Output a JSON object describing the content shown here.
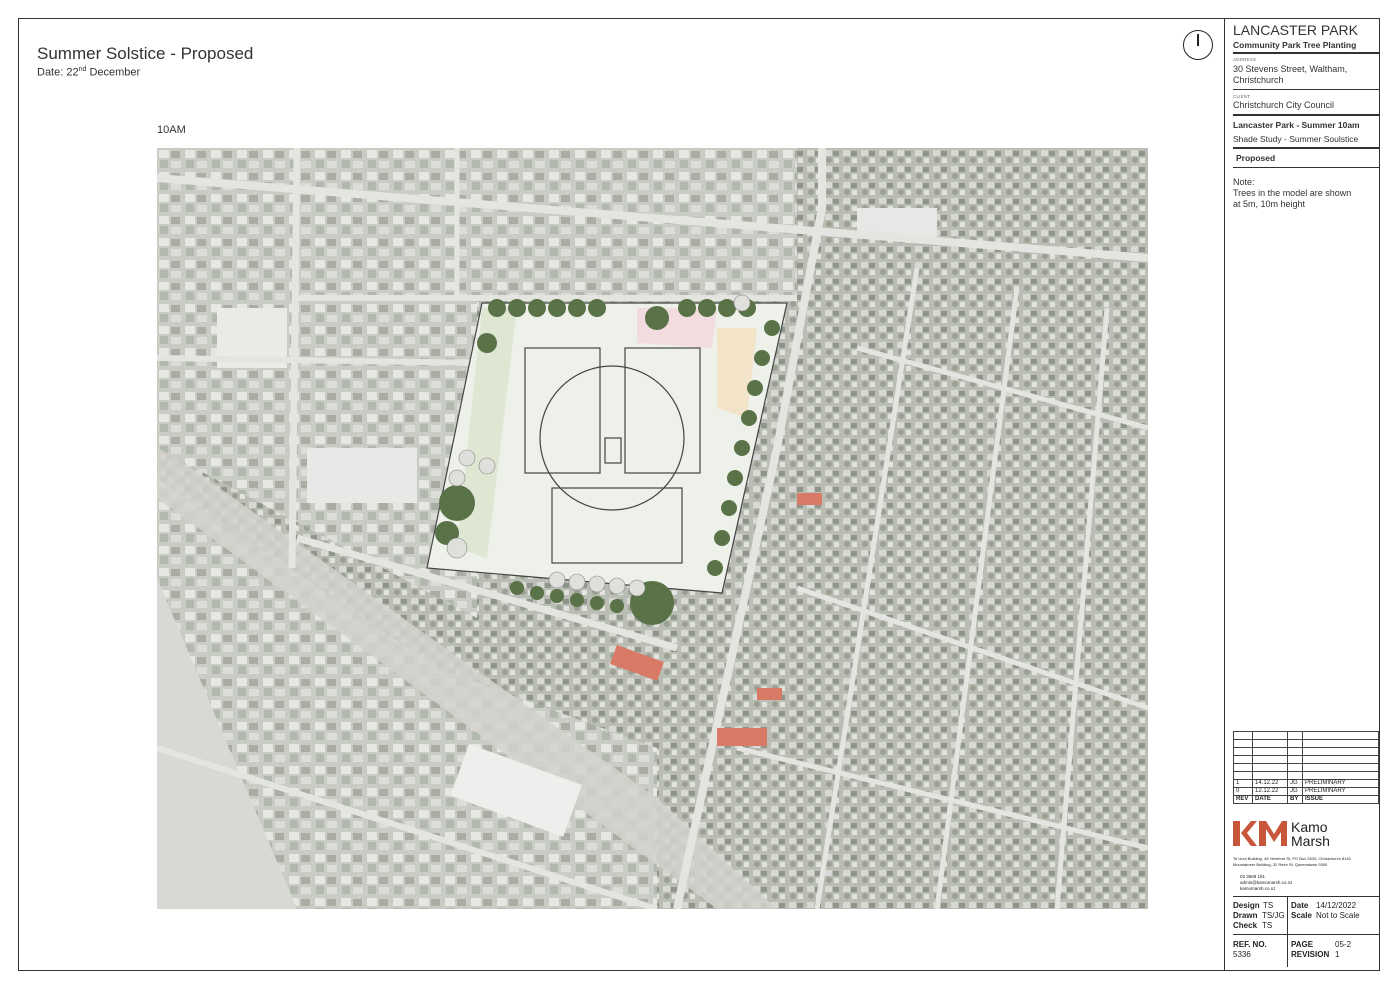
{
  "header": {
    "title": "Summer Solstice - Proposed",
    "date_prefix": "Date: 22",
    "date_sup": "nd",
    "date_suffix": " December",
    "time_label": "10AM"
  },
  "titleblock": {
    "project_name": "LANCASTER PARK",
    "project_subtitle": "Community Park Tree Planting",
    "address_label": "ADDRESS",
    "address_line1": "30 Stevens Street, Waltham,",
    "address_line2": "Christchurch",
    "client_label": "CLIENT",
    "client": "Christchurch City Council",
    "drawing_title": "Lancaster Park - Summer 10am",
    "drawing_subtitle": "Shade Study - Summer Soulstice",
    "status": "Proposed",
    "note_label": "Note:",
    "note_line1": "Trees in the model are shown",
    "note_line2": "at 5m, 10m height"
  },
  "revisions": {
    "rows": [
      {
        "rev": "1",
        "date": "14.12.22",
        "by": "JG",
        "issue": "PRELIMINARY"
      },
      {
        "rev": "0",
        "date": "12.12.22",
        "by": "JG",
        "issue": "PRELIMINARY"
      }
    ],
    "headers": {
      "rev": "REV",
      "date": "DATE",
      "by": "BY",
      "issue": "ISSUE"
    }
  },
  "company": {
    "name_line1": "Kamo",
    "name_line2": "Marsh",
    "brand_color": "#c8563a",
    "address_line1": "Te Unui Building, 48 Hereford St, PO Box 2833, Christchurch 8140",
    "address_line2": "Mountaineer Building, 32 Rees St, Queenstown 9300",
    "phone": "03 3668 181",
    "email": "admin@kamomarsh.co.nz",
    "web": "kamomarsh.co.nz"
  },
  "details": {
    "design_label": "Design",
    "design_value": "TS",
    "drawn_label": "Drawn",
    "drawn_value": "TS/JG",
    "check_label": "Check",
    "check_value": "TS",
    "date_label": "Date",
    "date_value": "14/12/2022",
    "scale_label": "Scale",
    "scale_value": "Not to Scale",
    "ref_label": "REF. NO.",
    "ref_value": "5336",
    "page_label": "PAGE",
    "page_value": "05-2",
    "revision_label": "REVISION",
    "revision_value": "1"
  }
}
